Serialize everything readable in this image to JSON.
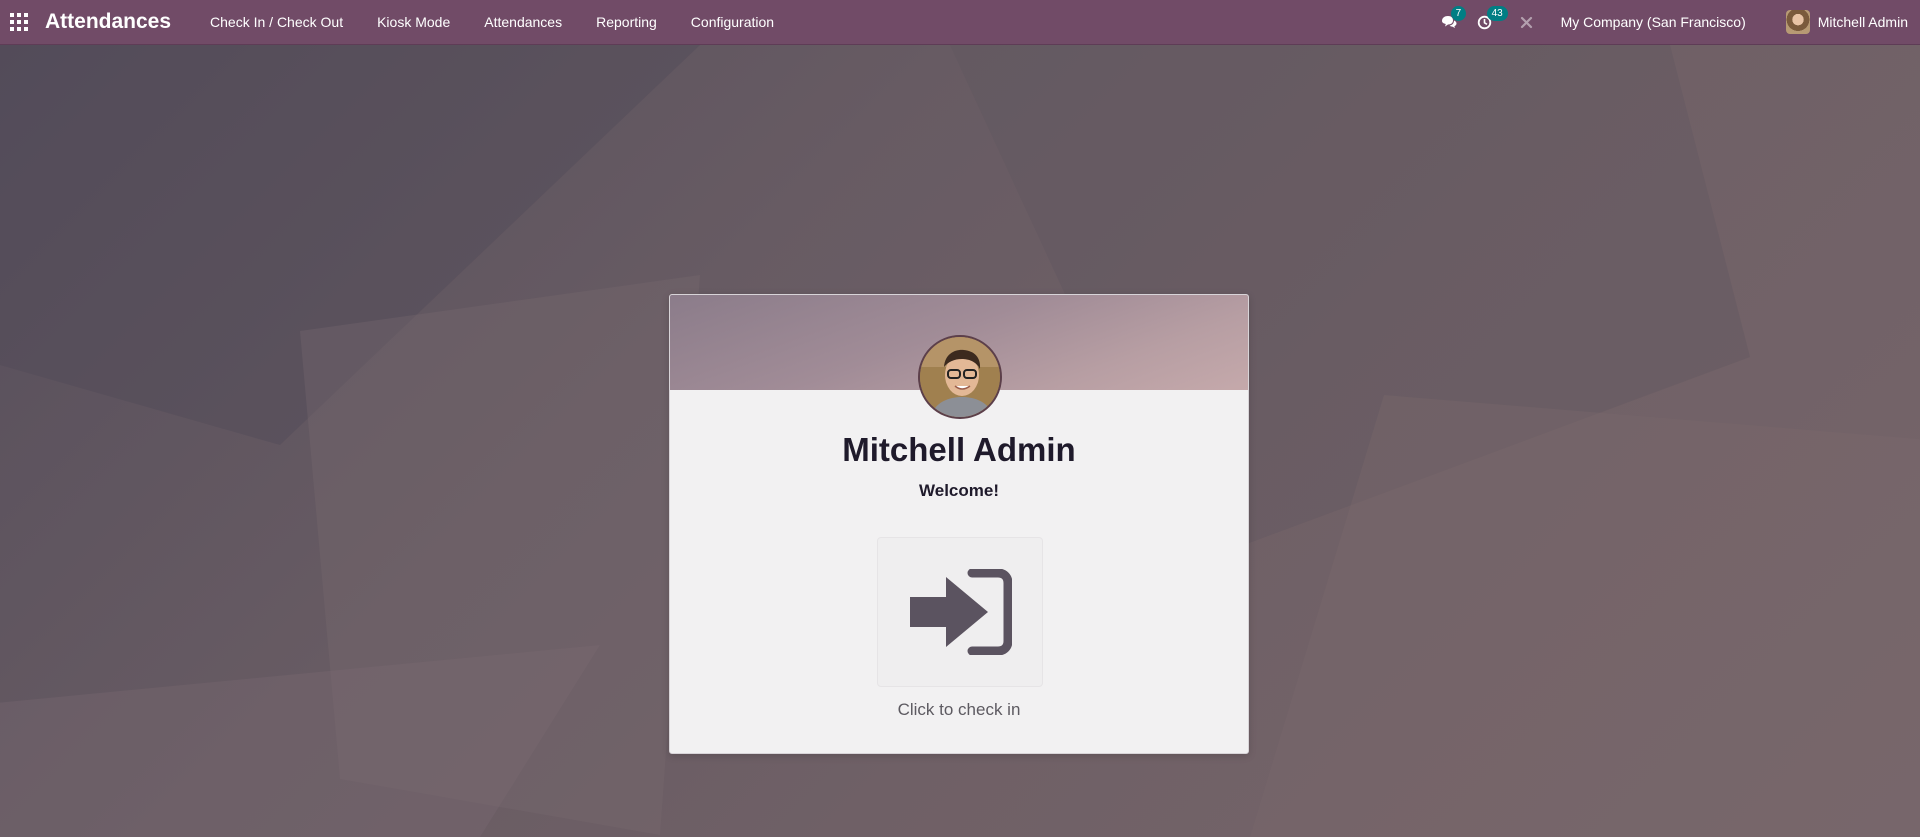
{
  "app": {
    "title": "Attendances"
  },
  "menu": [
    {
      "label": "Check In / Check Out"
    },
    {
      "label": "Kiosk Mode"
    },
    {
      "label": "Attendances"
    },
    {
      "label": "Reporting"
    },
    {
      "label": "Configuration"
    }
  ],
  "systray": {
    "messages_count": "7",
    "activities_count": "43",
    "company": "My Company (San Francisco)",
    "user": "Mitchell Admin"
  },
  "card": {
    "employee_name": "Mitchell Admin",
    "greeting": "Welcome!",
    "action_label": "Click to check in"
  },
  "colors": {
    "navbar": "#714b67",
    "badge": "#017e84",
    "icon": "#5b5360"
  },
  "icons": [
    "apps-grid-icon",
    "chat-icon",
    "clock-icon",
    "close-icon",
    "sign-in-icon"
  ]
}
